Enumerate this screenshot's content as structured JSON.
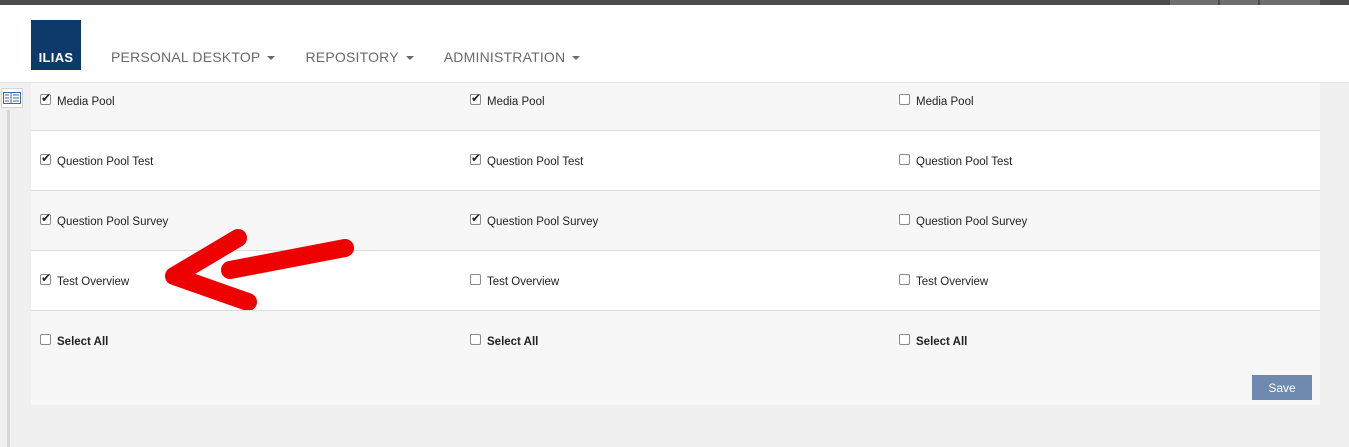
{
  "header": {
    "logo_text": "ILIAS",
    "nav": [
      {
        "label": "PERSONAL DESKTOP"
      },
      {
        "label": "REPOSITORY"
      },
      {
        "label": "ADMINISTRATION"
      }
    ]
  },
  "colors": {
    "logo_bg": "#0d3a6b",
    "save_button": "#6f8ab0",
    "annotation_arrow": "#ee0000"
  },
  "permissions": {
    "rows": [
      {
        "cells": [
          {
            "label": "Media Pool",
            "checked": true
          },
          {
            "label": "Media Pool",
            "checked": true
          },
          {
            "label": "Media Pool",
            "checked": false
          }
        ]
      },
      {
        "cells": [
          {
            "label": "Question Pool Test",
            "checked": true
          },
          {
            "label": "Question Pool Test",
            "checked": true
          },
          {
            "label": "Question Pool Test",
            "checked": false
          }
        ]
      },
      {
        "cells": [
          {
            "label": "Question Pool Survey",
            "checked": true
          },
          {
            "label": "Question Pool Survey",
            "checked": true
          },
          {
            "label": "Question Pool Survey",
            "checked": false
          }
        ]
      },
      {
        "cells": [
          {
            "label": "Test Overview",
            "checked": true
          },
          {
            "label": "Test Overview",
            "checked": false
          },
          {
            "label": "Test Overview",
            "checked": false
          }
        ]
      }
    ],
    "select_all": [
      {
        "label": "Select All",
        "checked": false
      },
      {
        "label": "Select All",
        "checked": false
      },
      {
        "label": "Select All",
        "checked": false
      }
    ]
  },
  "actions": {
    "save_label": "Save"
  },
  "icons": {
    "sidebar_toggle": "tree-view-icon",
    "annotation": "red-arrow-icon"
  }
}
